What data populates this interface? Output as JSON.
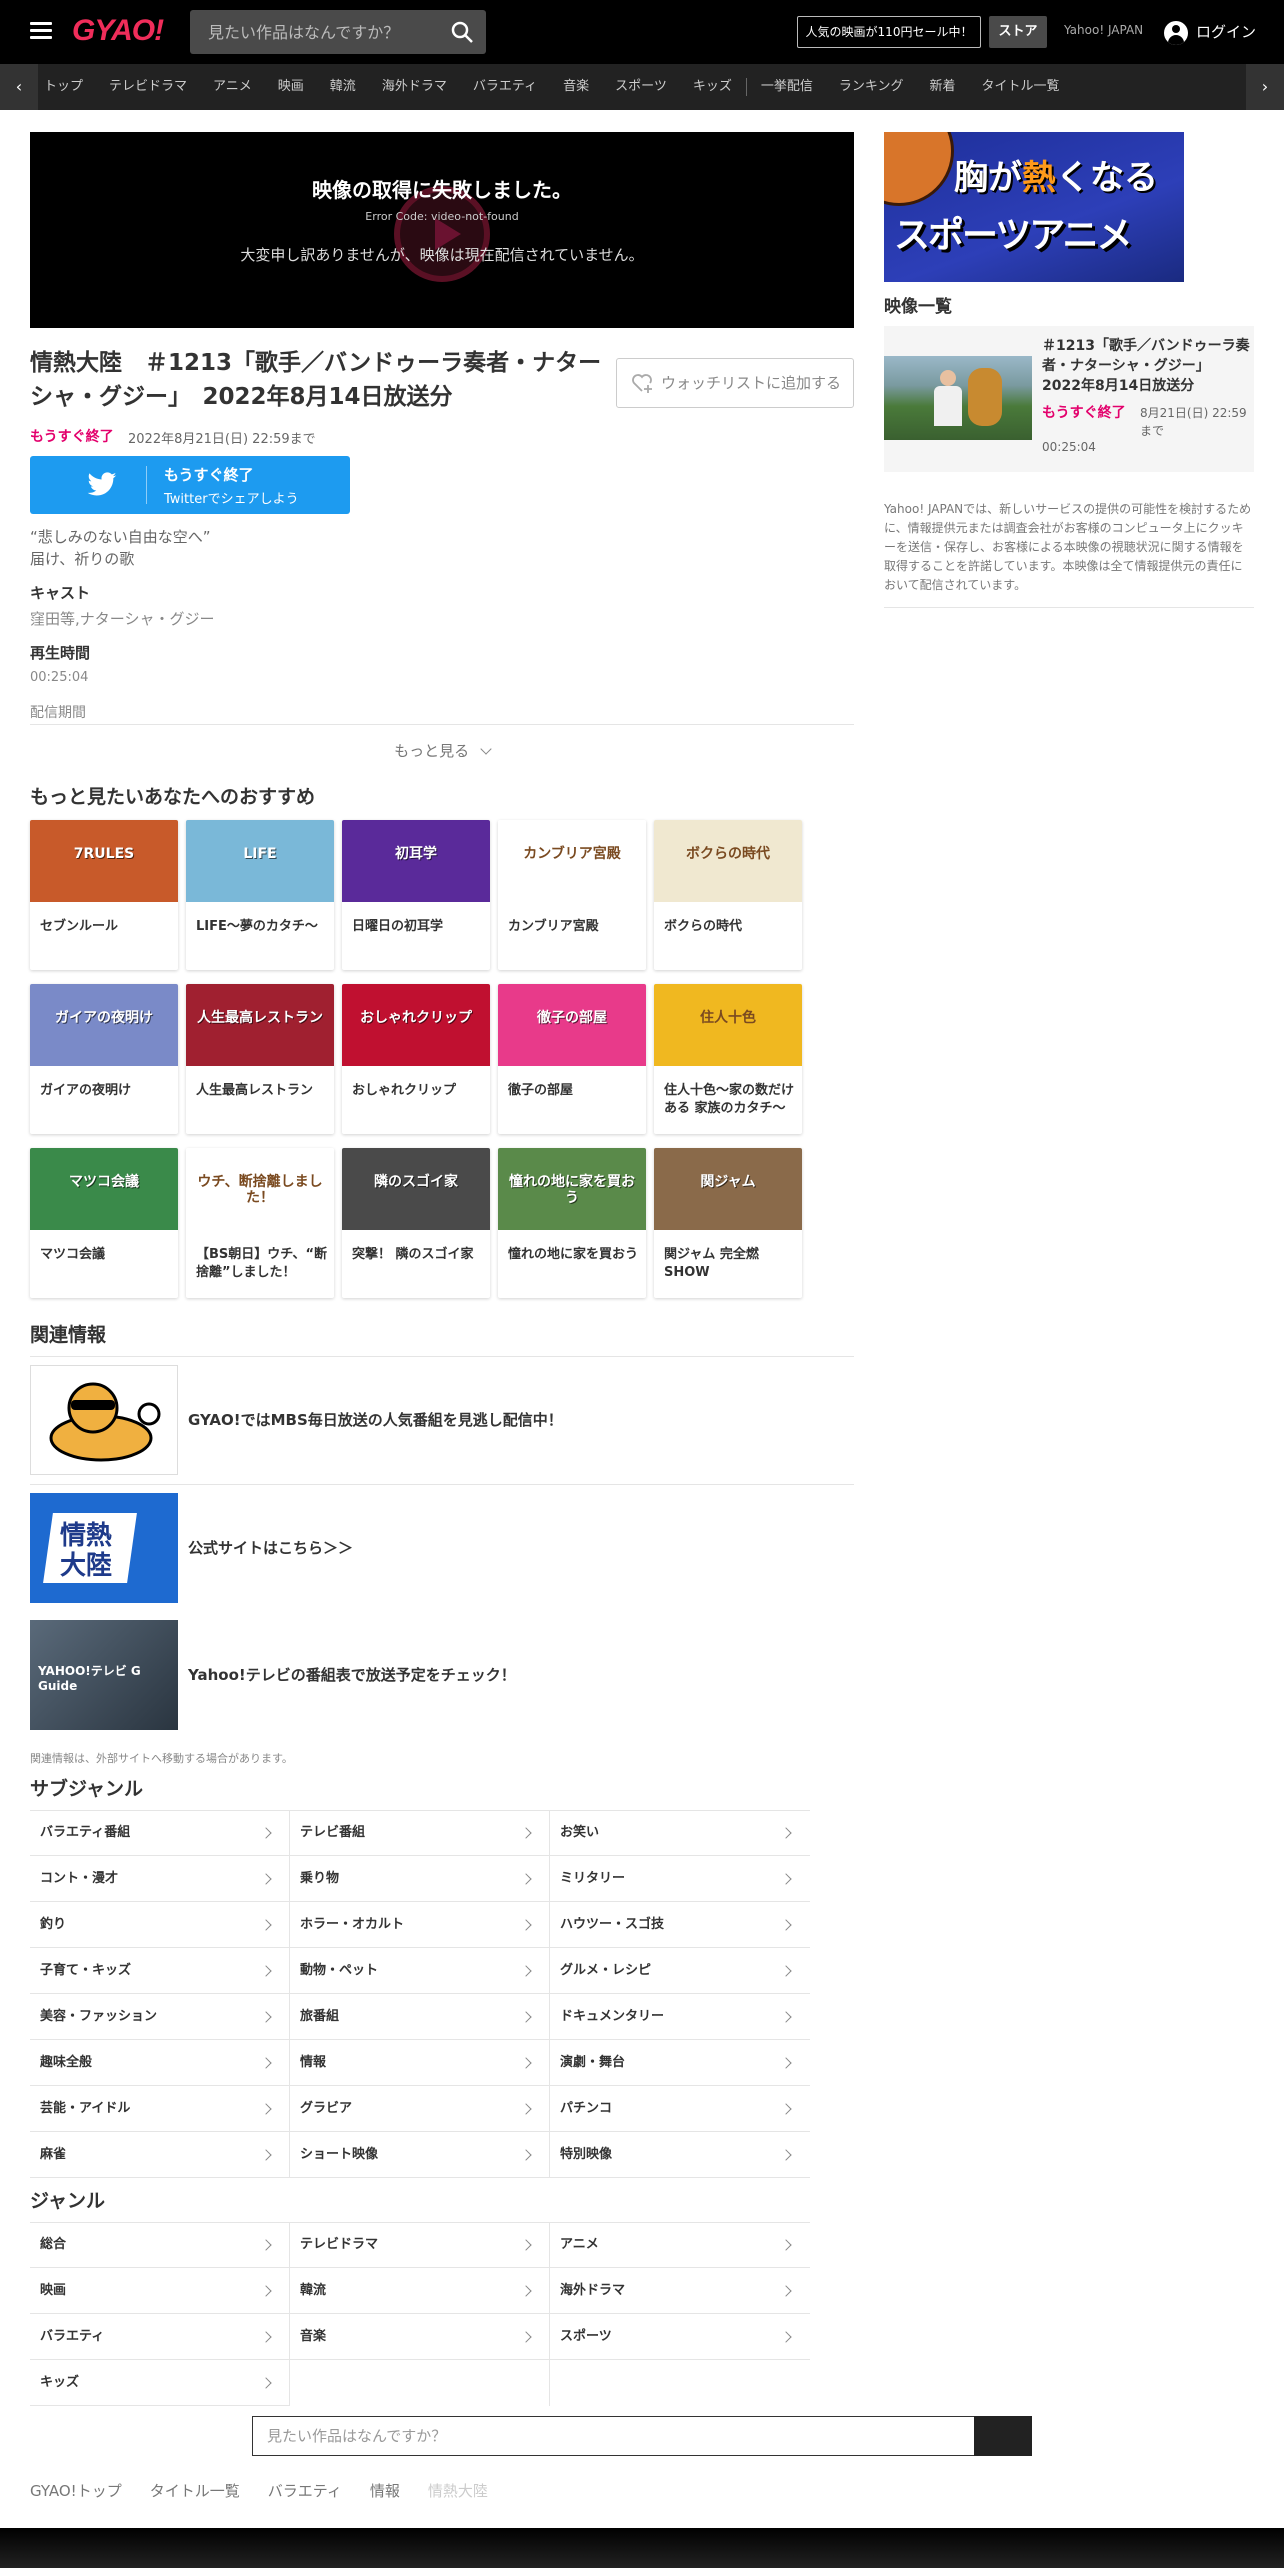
{
  "header": {
    "logo": "GYAO!",
    "search_placeholder": "見たい作品はなんですか？",
    "sale_label": "人気の映画が110円セール中！",
    "store_label": "ストア",
    "yahoo_label": "Yahoo! JAPAN",
    "login_label": "ログイン"
  },
  "category_nav": {
    "items": [
      "トップ",
      "テレビドラマ",
      "アニメ",
      "映画",
      "韓流",
      "海外ドラマ",
      "バラエティ",
      "音楽",
      "スポーツ",
      "キッズ",
      "一挙配信",
      "ランキング",
      "新着",
      "タイトル一覧"
    ]
  },
  "player": {
    "error_title": "映像の取得に失敗しました。",
    "error_code": "Error Code: video-not-found",
    "error_message": "大変申し訳ありませんが、映像は現在配信されていません。"
  },
  "episode": {
    "title": "情熱大陸　＃1213「歌手／バンドゥーラ奏者・ナターシャ・グジー」　2022年8月14日放送分",
    "watchlist_label": "ウォッチリストに追加する",
    "ending_soon": "もうすぐ終了",
    "available_until": "2022年8月21日(日) 22:59まで",
    "twitter_line1": "もうすぐ終了",
    "twitter_line2": "Twitterでシェアしよう",
    "description_line1": "“悲しみのない自由な空へ”",
    "description_line2": "届け、祈りの歌",
    "cast_label": "キャスト",
    "cast_value": "窪田等,ナターシャ・グジー",
    "duration_label": "再生時間",
    "duration_value": "00:25:04",
    "period_label": "配信期間",
    "more_label": "もっと見る"
  },
  "recommendations": {
    "heading": "もっと見たいあなたへのおすすめ",
    "items": [
      {
        "title": "セブンルール",
        "badge": "7RULES",
        "color": "#c85a2a"
      },
      {
        "title": "LIFE～夢のカタチ～",
        "badge": "LIFE",
        "color": "#7ab8d8"
      },
      {
        "title": "日曜日の初耳学",
        "badge": "初耳学",
        "color": "#5a2a9a"
      },
      {
        "title": "カンブリア宮殿",
        "badge": "カンブリア宮殿",
        "color": "#ffffff"
      },
      {
        "title": "ボクらの時代",
        "badge": "ボクらの時代",
        "color": "#f0e8d0"
      },
      {
        "title": "ガイアの夜明け",
        "badge": "ガイアの夜明け",
        "color": "#7a8ac8"
      },
      {
        "title": "人生最高レストラン",
        "badge": "人生最高レストラン",
        "color": "#a02030"
      },
      {
        "title": "おしゃれクリップ",
        "badge": "おしゃれクリップ",
        "color": "#c01030"
      },
      {
        "title": "徹子の部屋",
        "badge": "徹子の部屋",
        "color": "#e83a8a"
      },
      {
        "title": "住人十色～家の数だけある 家族のカタチ～",
        "badge": "住人十色",
        "color": "#f0b820"
      },
      {
        "title": "マツコ会議",
        "badge": "マツコ会議",
        "color": "#3a8a4a"
      },
      {
        "title": "【BS朝日】ウチ、“断捨離”しました！",
        "badge": "ウチ、断捨離しました！",
        "color": "#ffffff"
      },
      {
        "title": "突撃！ 隣のスゴイ家",
        "badge": "隣のスゴイ家",
        "color": "#4a4a4a"
      },
      {
        "title": "憧れの地に家を買おう",
        "badge": "憧れの地に家を買おう",
        "color": "#5a8a4a"
      },
      {
        "title": "関ジャム 完全燃SHOW",
        "badge": "関ジャム",
        "color": "#8a6a4a"
      }
    ]
  },
  "related": {
    "heading": "関連情報",
    "items": [
      {
        "text": "GYAO!ではMBS毎日放送の人気番組を見逃し配信中！"
      },
      {
        "text": "公式サイトはこちら＞＞",
        "thumb_text": "情熱大陸"
      },
      {
        "text": "Yahoo!テレビの番組表で放送予定をチェック！",
        "thumb_text": "YAHOO!テレビ G Guide"
      }
    ],
    "note": "関連情報は、外部サイトへ移動する場合があります。"
  },
  "subgenre": {
    "heading": "サブジャンル",
    "items": [
      "バラエティ番組",
      "テレビ番組",
      "お笑い",
      "コント・漫才",
      "乗り物",
      "ミリタリー",
      "釣り",
      "ホラー・オカルト",
      "ハウツー・スゴ技",
      "子育て・キッズ",
      "動物・ペット",
      "グルメ・レシピ",
      "美容・ファッション",
      "旅番組",
      "ドキュメンタリー",
      "趣味全般",
      "情報",
      "演劇・舞台",
      "芸能・アイドル",
      "グラビア",
      "パチンコ",
      "麻雀",
      "ショート映像",
      "特別映像"
    ]
  },
  "genre": {
    "heading": "ジャンル",
    "items": [
      "総合",
      "テレビドラマ",
      "アニメ",
      "映画",
      "韓流",
      "海外ドラマ",
      "バラエティ",
      "音楽",
      "スポーツ",
      "キッズ"
    ]
  },
  "footer": {
    "search_placeholder": "見たい作品はなんですか？",
    "breadcrumb": [
      "GYAO!トップ",
      "タイトル一覧",
      "バラエティ",
      "情報",
      "情熱大陸"
    ]
  },
  "sidebar": {
    "banner_line1_a": "胸が",
    "banner_line1_b": "熱",
    "banner_line1_c": "くなる",
    "banner_line2": "スポーツアニメ",
    "video_list_heading": "映像一覧",
    "video_item": {
      "title": "＃1213「歌手／バンドゥーラ奏者・ナターシャ・グジー」　2022年8月14日放送分",
      "ending_soon": "もうすぐ終了",
      "until": "8月21日(日) 22:59まで",
      "duration": "00:25:04"
    },
    "notice": "Yahoo! JAPANでは、新しいサービスの提供の可能性を検討するために、情報提供元または調査会社がお客様のコンピュータ上にクッキーを送信・保存し、お客様による本映像の視聴状況に関する情報を取得することを許諾しています。本映像は全て情報提供元の責任において配信されています。"
  },
  "colors": {
    "brand": "#f02d5a",
    "ending_soon": "#e3006c",
    "twitter": "#1d9bf0",
    "header_bg": "#000000"
  }
}
